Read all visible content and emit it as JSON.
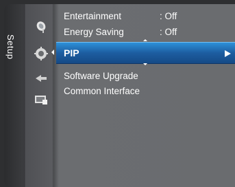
{
  "sidebar": {
    "label": "Setup"
  },
  "menu": {
    "items": [
      {
        "label": "Entertainment",
        "value": ": Off"
      },
      {
        "label": "Energy Saving",
        "value": ": Off"
      },
      {
        "label": "PIP",
        "selected": true
      },
      {
        "label": "Software Upgrade"
      },
      {
        "label": "Common Interface"
      }
    ]
  },
  "icons": [
    "satellite-dish-icon",
    "gear-icon",
    "input-icon",
    "support-icon"
  ],
  "colors": {
    "accent": "#1f6fc0",
    "panel": "#6a6c6f",
    "text": "#ffffff"
  }
}
